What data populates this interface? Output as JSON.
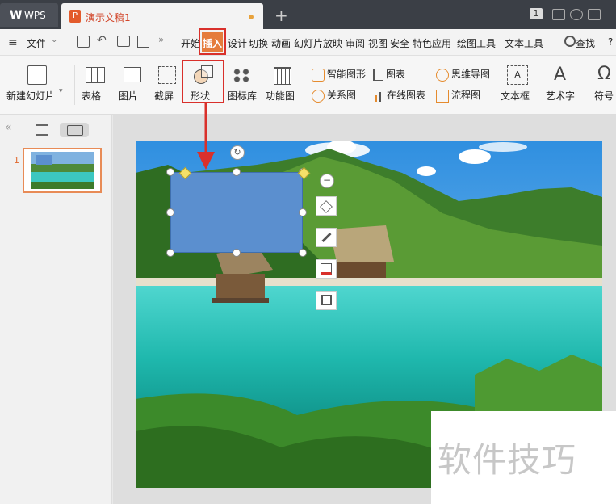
{
  "titlebar": {
    "app_tab": "WPS",
    "doc_tab": "演示文稿1",
    "new_tab": "+",
    "badge": "1"
  },
  "menubar": {
    "file": "文件",
    "items": [
      "开始",
      "插入",
      "设计",
      "切换",
      "动画",
      "幻灯片放映",
      "审阅",
      "视图",
      "安全",
      "特色应用",
      "绘图工具",
      "文本工具"
    ],
    "search": "查找",
    "help": "?"
  },
  "toolbar": {
    "new_slide": "新建幻灯片",
    "table": "表格",
    "picture": "图片",
    "screenshot": "截屏",
    "shape": "形状",
    "icon_lib": "图标库",
    "func_chart": "功能图",
    "smart_art": "智能图形",
    "chart": "图表",
    "mind_map": "思维导图",
    "relation": "关系图",
    "online_chart": "在线图表",
    "flowchart": "流程图",
    "textbox": "文本框",
    "art_text": "艺术字",
    "symbol": "符号"
  },
  "sidebar": {
    "collapse": "«",
    "slide_number": "1"
  },
  "watermark": "软件技巧",
  "colors": {
    "accent": "#d9302b",
    "insert_tab": "#e57c3c",
    "shape_fill": "#5b8fcf"
  }
}
